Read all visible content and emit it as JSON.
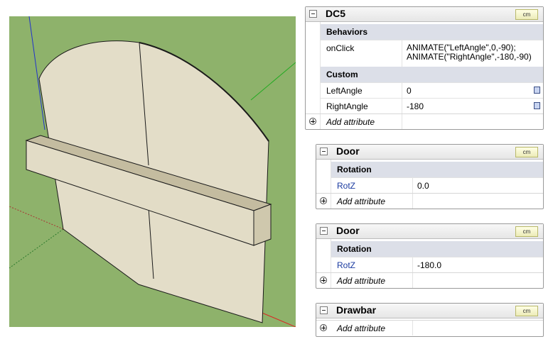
{
  "viewport": {
    "background": "#8eb26b",
    "face_color": "#e3ddc8",
    "bar_color": "#d8d1b6"
  },
  "panels": {
    "dc5": {
      "title": "DC5",
      "unit": "cm",
      "sections": {
        "behaviors": "Behaviors",
        "custom": "Custom"
      },
      "rows": {
        "onclick": {
          "label": "onClick",
          "value_line1": "ANIMATE(\"LeftAngle\",0,-90);",
          "value_line2": "ANIMATE(\"RightAngle\",-180,-90)"
        },
        "leftangle": {
          "label": "LeftAngle",
          "value": "0"
        },
        "rightangle": {
          "label": "RightAngle",
          "value": "-180"
        }
      },
      "add": "Add attribute"
    },
    "door1": {
      "title": "Door",
      "unit": "cm",
      "section": "Rotation",
      "row": {
        "label": "RotZ",
        "value": "0.0"
      },
      "add": "Add attribute"
    },
    "door2": {
      "title": "Door",
      "unit": "cm",
      "section": "Rotation",
      "row": {
        "label": "RotZ",
        "value": "-180.0"
      },
      "add": "Add attribute"
    },
    "drawbar": {
      "title": "Drawbar",
      "unit": "cm",
      "add": "Add attribute"
    }
  }
}
